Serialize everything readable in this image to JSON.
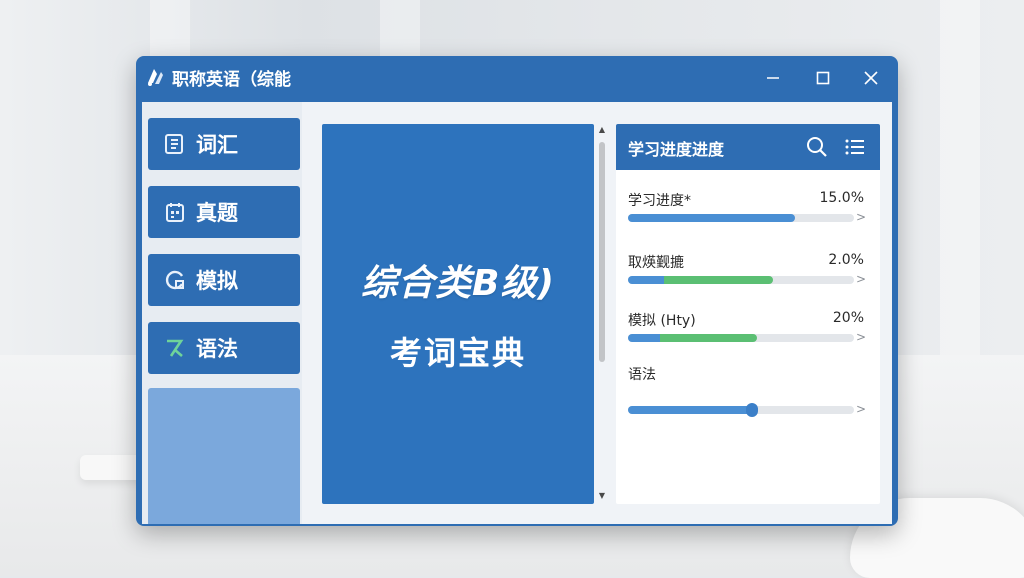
{
  "window": {
    "title": "职称英语（综能",
    "controls": {
      "minimize": "minimize",
      "maximize": "maximize",
      "close": "close"
    }
  },
  "sidebar": {
    "items": [
      {
        "label": "词汇",
        "icon": "book-icon"
      },
      {
        "label": "真题",
        "icon": "calendar-icon"
      },
      {
        "label": "模拟",
        "icon": "refresh-icon"
      },
      {
        "label": "语法",
        "icon": "grammar-icon"
      }
    ]
  },
  "center": {
    "line1": "综合类B级)",
    "line2": "考词宝典"
  },
  "progress_panel": {
    "title": "学习进度进度",
    "rows": [
      {
        "label": "学习进度*",
        "value": "15.0%",
        "fill": 0.74,
        "bar_color": "blue"
      },
      {
        "label": "取煐觐摝",
        "value": "2.0%",
        "fill": 0.64,
        "bar_color": "green"
      },
      {
        "label": "模拟 (Hty)",
        "value": "20%",
        "fill": 0.57,
        "bar_color": "green"
      },
      {
        "label": "语法",
        "value": "",
        "fill": 0.55,
        "bar_color": "blue"
      }
    ]
  },
  "colors": {
    "primary": "#2e6db3",
    "progress_blue": "#4a8fd4",
    "progress_green": "#5bbf73"
  }
}
